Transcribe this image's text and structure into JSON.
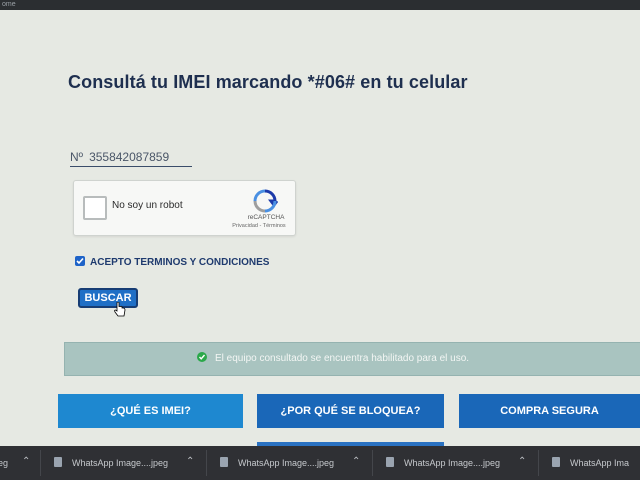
{
  "topbar": {
    "text": "ome"
  },
  "page": {
    "title": "Consultá tu IMEI marcando *#06# en tu celular",
    "imei": {
      "prefix": "Nº",
      "value": "355842087859"
    },
    "captcha": {
      "label": "No soy un robot",
      "brand": "reCAPTCHA",
      "links": "Privacidad - Términos"
    },
    "terms_label": "ACEPTO TERMINOS Y CONDICIONES",
    "terms_checked": true,
    "search_button": "BUSCAR",
    "alert_text": "El equipo consultado se encuentra habilitado para el uso.",
    "alert_color": "#a9c4c0",
    "nav": [
      {
        "label": "¿QUÉ ES IMEI?"
      },
      {
        "label": "¿POR QUÉ SE BLOQUEA?"
      },
      {
        "label": "COMPRA SEGURA"
      }
    ]
  },
  "taskbar": {
    "first_partial": "eg",
    "downloads": [
      {
        "name": "WhatsApp Image....jpeg"
      },
      {
        "name": "WhatsApp Image....jpeg"
      },
      {
        "name": "WhatsApp Image....jpeg"
      },
      {
        "name": "WhatsApp Ima"
      }
    ]
  }
}
